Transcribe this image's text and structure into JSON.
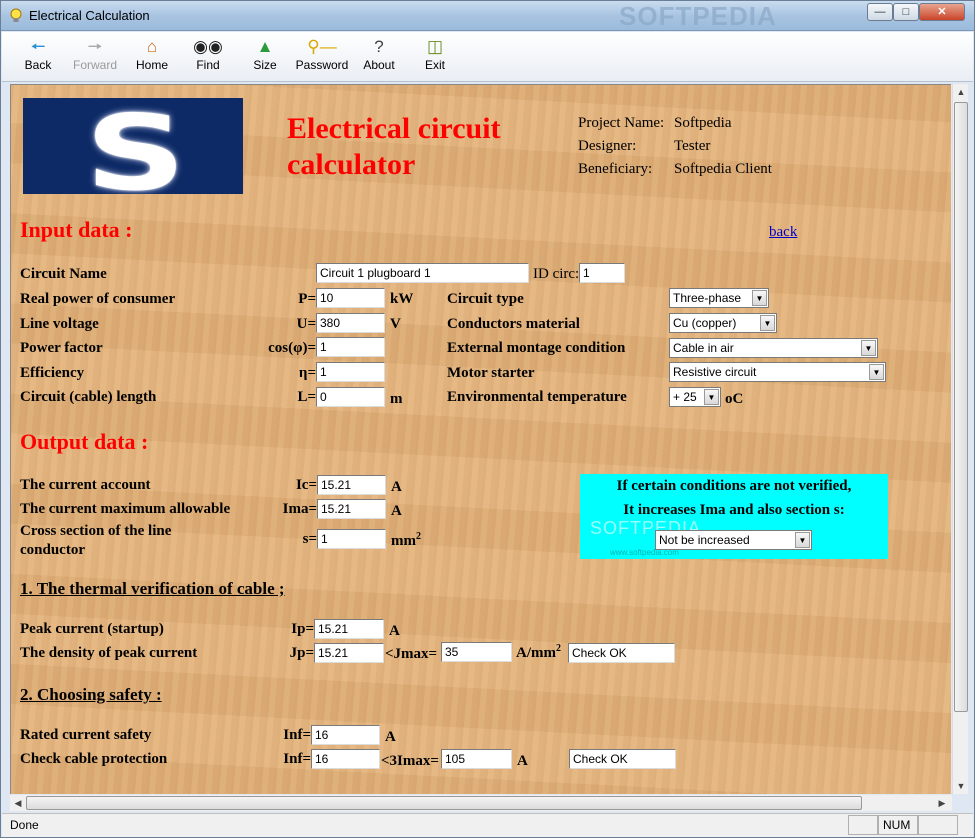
{
  "window": {
    "title": "Electrical Calculation",
    "watermark": "SOFTPEDIA"
  },
  "toolbar": {
    "back": "Back",
    "forward": "Forward",
    "home": "Home",
    "find": "Find",
    "size": "Size",
    "password": "Password",
    "about": "About",
    "exit": "Exit"
  },
  "header": {
    "title_line1": "Electrical circuit",
    "title_line2": "calculator",
    "logo_letter": "S",
    "project_label": "Project Name:",
    "project_value": "Softpedia",
    "designer_label": "Designer:",
    "designer_value": "Tester",
    "beneficiary_label": "Beneficiary:",
    "beneficiary_value": "Softpedia Client"
  },
  "input": {
    "heading": "Input data :",
    "back_link": "back",
    "circuit_name_label": "Circuit Name",
    "circuit_name_value": "Circuit 1 plugboard 1",
    "id_circ_label": "ID circ:",
    "id_circ_value": "1",
    "real_power_label": "Real power of consumer",
    "real_power_sym": "P=",
    "real_power_value": "10",
    "real_power_unit": "kW",
    "line_voltage_label": "Line voltage",
    "line_voltage_sym": "U=",
    "line_voltage_value": "380",
    "line_voltage_unit": "V",
    "power_factor_label": "Power factor",
    "power_factor_sym": "cos(φ)=",
    "power_factor_value": "1",
    "efficiency_label": "Efficiency",
    "efficiency_sym": "η=",
    "efficiency_value": "1",
    "length_label": "Circuit (cable) length",
    "length_sym": "L=",
    "length_value": "0",
    "length_unit": "m",
    "circuit_type_label": "Circuit type",
    "circuit_type_value": "Three-phase",
    "material_label": "Conductors material",
    "material_value": "Cu (copper)",
    "montage_label": "External montage condition",
    "montage_value": "Cable in air",
    "starter_label": "Motor starter",
    "starter_value": "Resistive circuit",
    "temp_label": "Environmental temperature",
    "temp_value": "+ 25",
    "temp_unit": "oC"
  },
  "output": {
    "heading": "Output data :",
    "ic_label": "The current account",
    "ic_sym": "Ic=",
    "ic_value": "15.21",
    "ic_unit": "A",
    "ima_label": "The current maximum allowable",
    "ima_sym": "Ima=",
    "ima_value": "15.21",
    "ima_unit": "A",
    "section_label_1": "Cross section of the line",
    "section_label_2": "conductor",
    "section_sym": "s=",
    "section_value": "1",
    "section_unit": "mm",
    "section_unit_sup": "2",
    "note_line1": "If certain conditions are not verified,",
    "note_line2": "It increases Ima and also section s:",
    "note_select": "Not be increased",
    "note_watermark": "SOFTPEDIA",
    "note_watermark_url": "www.softpedia.com"
  },
  "thermal": {
    "heading": "1. The thermal verification of cable ;",
    "ip_label": "Peak current (startup)",
    "ip_sym": "Ip=",
    "ip_value": "15.21",
    "ip_unit": "A",
    "jp_label": "The density of peak current",
    "jp_sym": "Jp=",
    "jp_value": "15.21",
    "jmax_sym": "<Jmax=",
    "jmax_value": "35",
    "jmax_unit": "A/mm",
    "jmax_unit_sup": "2",
    "check": "Check OK"
  },
  "safety": {
    "heading": "2. Choosing safety :",
    "rated_label": "Rated current safety",
    "rated_sym": "Inf=",
    "rated_value": "16",
    "rated_unit": "A",
    "protect_label": "Check cable protection",
    "protect_sym": "Inf=",
    "protect_value": "16",
    "imax_sym": "<3Imax=",
    "imax_value": "105",
    "imax_unit": "A",
    "check": "Check OK"
  },
  "status": {
    "text": "Done",
    "num": "NUM"
  }
}
